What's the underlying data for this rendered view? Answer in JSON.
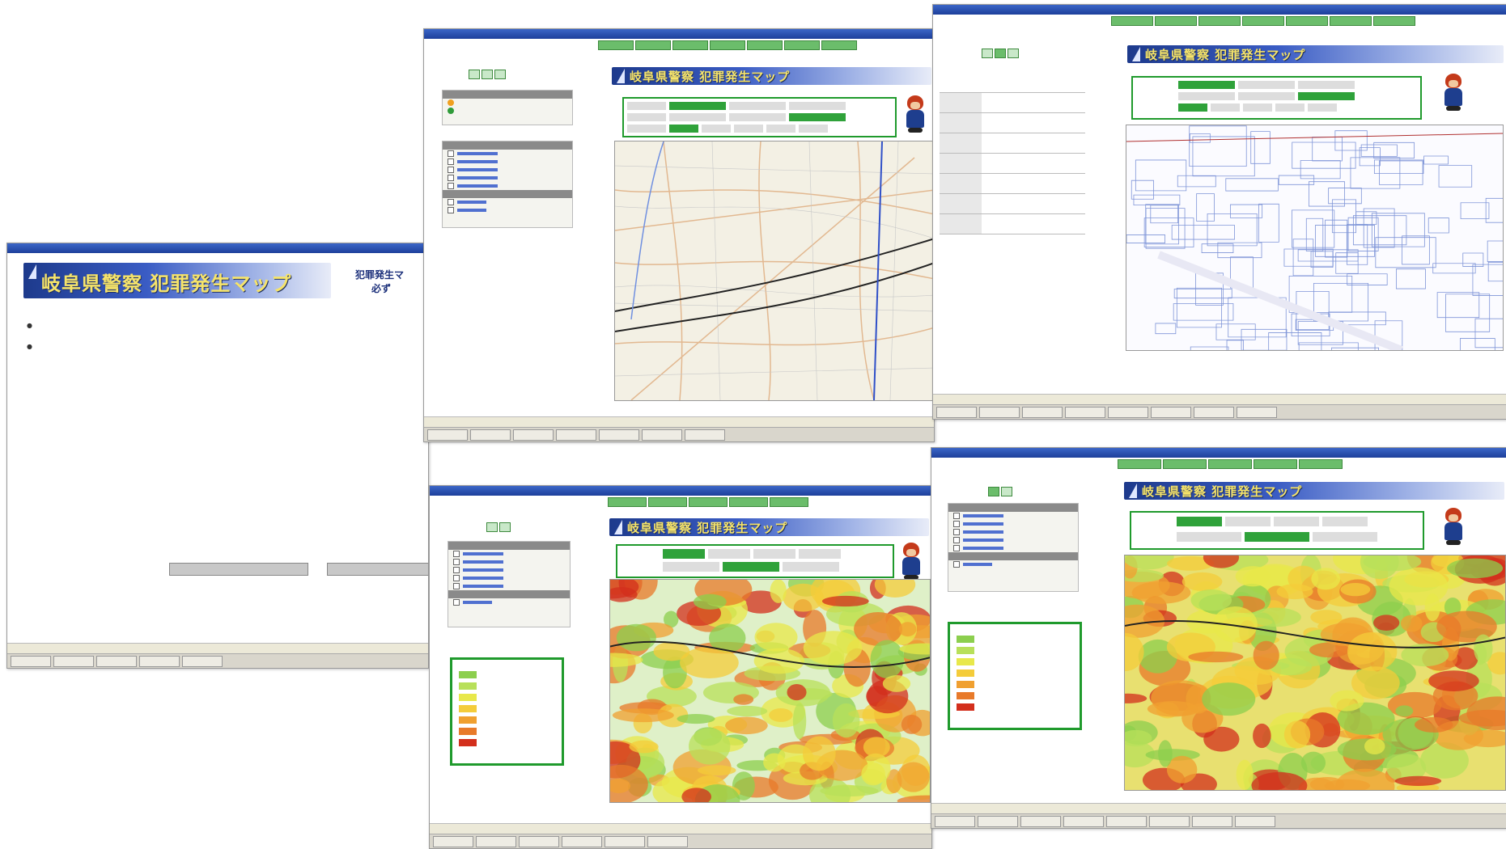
{
  "app": {
    "banner_title": "岐阜県警察 犯罪発生マップ"
  },
  "window1": {
    "title": "",
    "side_title_1": "犯罪発生マ",
    "side_title_2": "必ず",
    "body_lines": [
      "●",
      "",
      "●",
      "",
      "",
      "",
      "",
      "",
      "",
      "",
      "",
      "",
      ""
    ],
    "button_1": "",
    "button_2": "",
    "status": ""
  },
  "window2": {
    "tabs": [
      "",
      "",
      ""
    ],
    "legend_head": "",
    "legend_items": [
      "",
      ""
    ],
    "layer_head": "",
    "layers": [
      "",
      "",
      "",
      "",
      ""
    ],
    "layer_head_2": "",
    "layers_2": [
      "",
      ""
    ],
    "form_title": "",
    "status": ""
  },
  "window3": {
    "tabs": [
      "",
      "",
      ""
    ],
    "form_rows": [
      {
        "k": "",
        "v": ""
      },
      {
        "k": "",
        "v": ""
      },
      {
        "k": "",
        "v": ""
      },
      {
        "k": "",
        "v": ""
      },
      {
        "k": "",
        "v": ""
      },
      {
        "k": "",
        "v": ""
      },
      {
        "k": "",
        "v": ""
      }
    ],
    "status": ""
  },
  "window4": {
    "tabs": [
      "",
      ""
    ],
    "layer_head": "",
    "status": ""
  },
  "window5": {
    "tabs": [
      "",
      ""
    ],
    "layer_head": "",
    "status": ""
  },
  "colors": {
    "accent_green": "#1f9a2c",
    "banner_blue": "#1d3a8c",
    "banner_text": "#f6e46a",
    "heat_high": "#d32f1c",
    "heat_low": "#8ccf4e"
  },
  "icons": [
    "shield-icon",
    "map-pin-icon",
    "police-mascot-icon",
    "incident-marker-icon"
  ]
}
